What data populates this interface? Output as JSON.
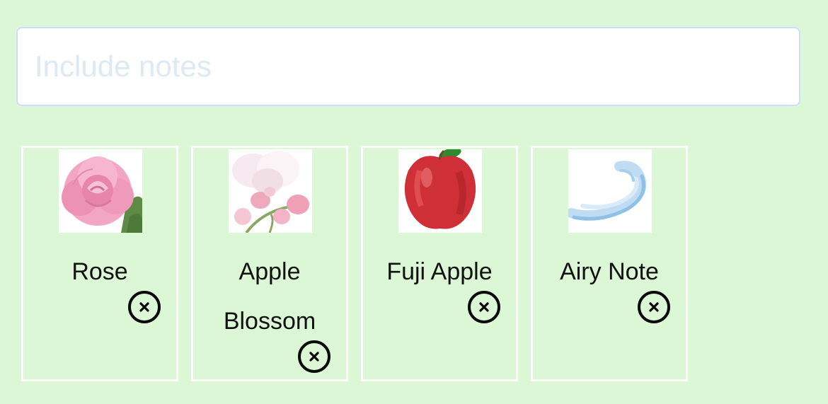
{
  "notes_input": {
    "placeholder": "Include notes",
    "value": ""
  },
  "selected_notes": [
    {
      "label": "Rose",
      "image_icon": "rose-image"
    },
    {
      "label": "Apple Blossom",
      "image_icon": "apple-blossom-image"
    },
    {
      "label": "Fuji Apple",
      "image_icon": "fuji-apple-image"
    },
    {
      "label": "Airy Note",
      "image_icon": "airy-swirl-image"
    }
  ],
  "remove_icon": "close-circle-icon",
  "colors": {
    "background": "#dcf7d6",
    "card_border": "#ffffff",
    "input_border": "#c9e0ef",
    "placeholder": "#dde9f3"
  }
}
